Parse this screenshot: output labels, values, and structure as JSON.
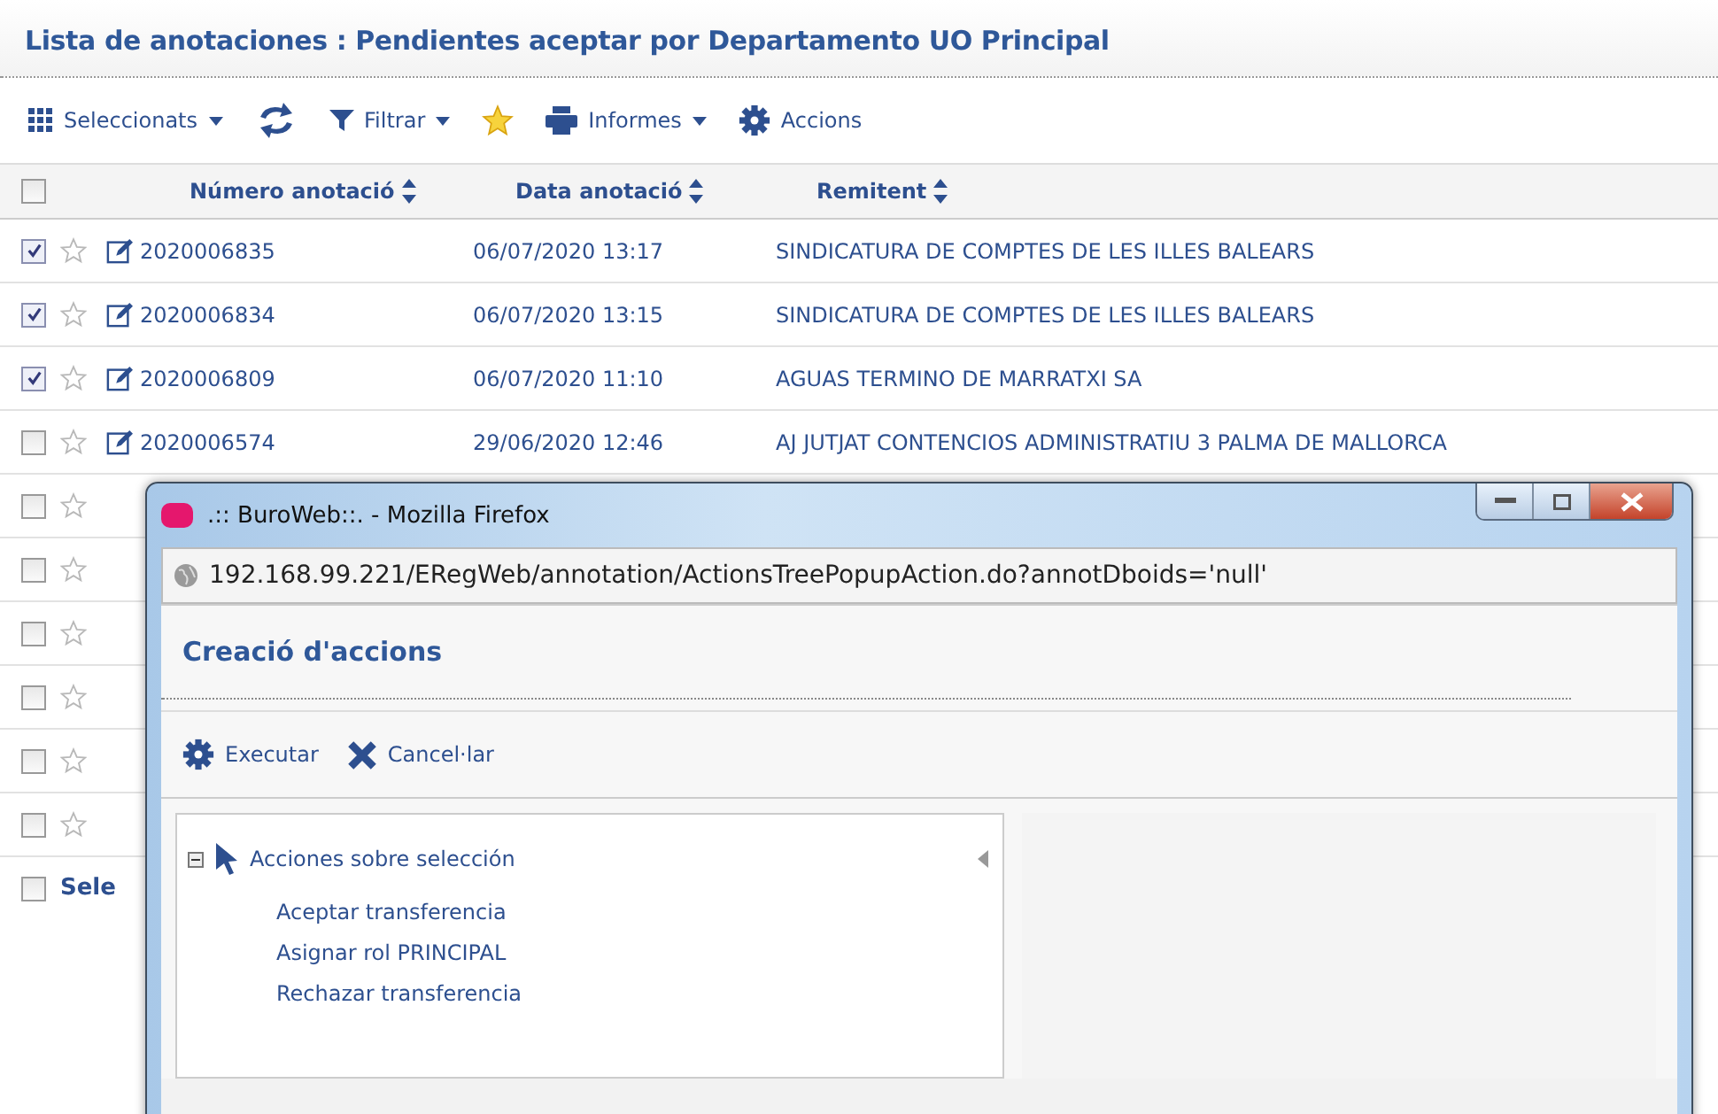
{
  "page": {
    "title": "Lista de anotaciones : Pendientes aceptar por Departamento UO Principal"
  },
  "toolbar": {
    "selected_menu": "Seleccionats",
    "filter_menu": "Filtrar",
    "reports_menu": "Informes",
    "actions": "Accions"
  },
  "table": {
    "header_checked": false,
    "columns": [
      "Número anotació",
      "Data anotació",
      "Remitent"
    ],
    "rows": [
      {
        "checked": true,
        "number": "2020006835",
        "date": "06/07/2020 13:17",
        "sender": "SINDICATURA DE COMPTES DE LES ILLES BALEARS"
      },
      {
        "checked": true,
        "number": "2020006834",
        "date": "06/07/2020 13:15",
        "sender": "SINDICATURA DE COMPTES DE LES ILLES BALEARS"
      },
      {
        "checked": true,
        "number": "2020006809",
        "date": "06/07/2020 11:10",
        "sender": "AGUAS TERMINO DE MARRATXI SA"
      },
      {
        "checked": false,
        "number": "2020006574",
        "date": "29/06/2020 12:46",
        "sender": "AJ JUTJAT CONTENCIOS ADMINISTRATIU 3 PALMA DE MALLORCA"
      },
      {
        "checked": false
      },
      {
        "checked": false
      },
      {
        "checked": false
      },
      {
        "checked": false
      },
      {
        "checked": false
      },
      {
        "checked": false
      }
    ],
    "footer": {
      "checked": false,
      "label": "Sele"
    }
  },
  "popup": {
    "title": ".:: BuroWeb::. - Mozilla Firefox",
    "url": "192.168.99.221/ERegWeb/annotation/ActionsTreePopupAction.do?annotDboids='null'",
    "heading": "Creació d'accions",
    "buttons": [
      {
        "kind": "execute",
        "label": "Executar"
      },
      {
        "kind": "cancel",
        "label": "Cancel·lar"
      }
    ],
    "tree": [
      {
        "label": "Acciones sobre selección",
        "expanded": true,
        "children": [
          {
            "label": "Aceptar transferencia"
          },
          {
            "label": "Asignar rol PRINCIPAL"
          },
          {
            "label": "Rechazar transferencia"
          }
        ]
      }
    ]
  }
}
